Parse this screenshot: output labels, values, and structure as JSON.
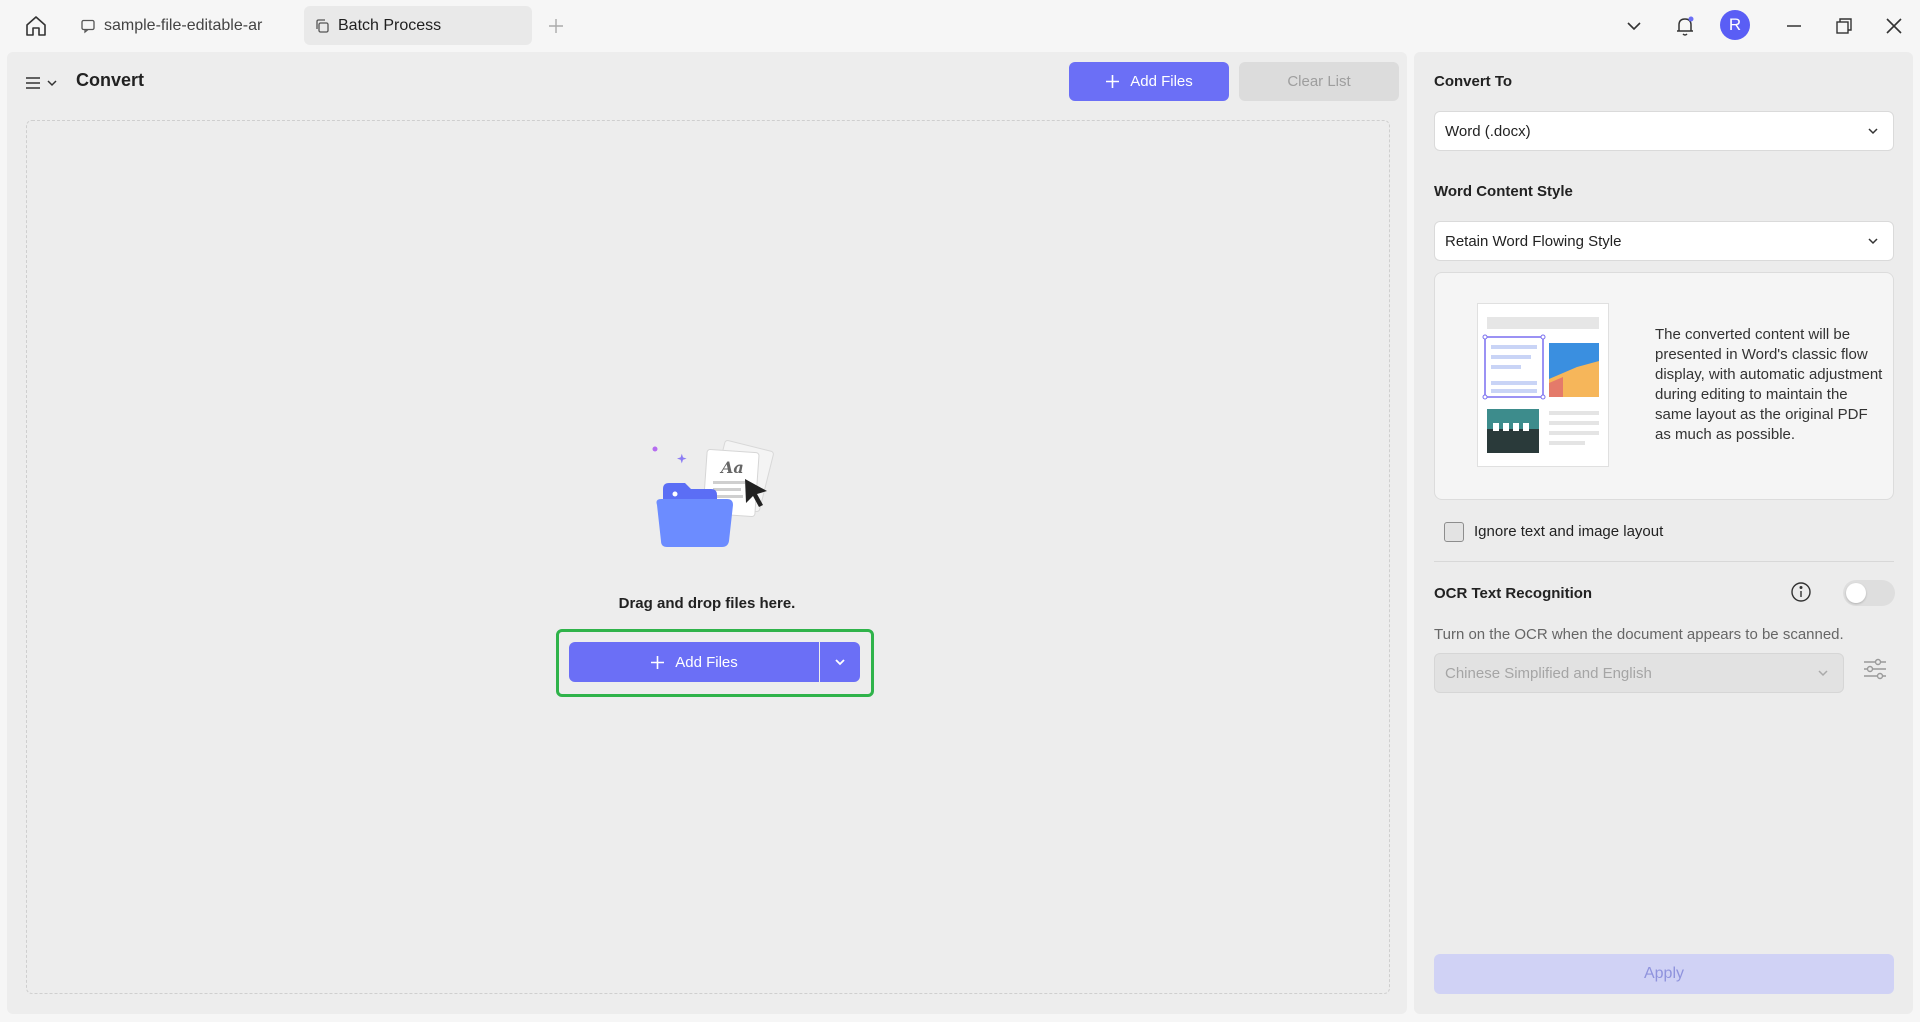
{
  "titlebar": {
    "tabs": [
      {
        "label": "sample-file-editable-ar",
        "icon": "comment-icon"
      },
      {
        "label": "Batch Process",
        "icon": "batch-copy-icon"
      }
    ],
    "avatar_letter": "R"
  },
  "main": {
    "title": "Convert",
    "add_files_label": "Add Files",
    "clear_list_label": "Clear List",
    "drop_text": "Drag and drop files here.",
    "center_add_label": "Add Files"
  },
  "side": {
    "convert_to_label": "Convert To",
    "convert_to_value": "Word (.docx)",
    "content_style_label": "Word Content Style",
    "content_style_value": "Retain Word Flowing Style",
    "style_description": "The converted content will be presented in Word's classic flow display, with automatic adjustment during editing to maintain the same layout as the original PDF as much as possible.",
    "ignore_layout_label": "Ignore text and image layout",
    "ignore_layout_checked": false,
    "ocr_label": "OCR Text Recognition",
    "ocr_enabled": false,
    "ocr_hint": "Turn on the OCR when the document appears to be scanned.",
    "ocr_language": "Chinese Simplified and English",
    "apply_label": "Apply"
  },
  "colors": {
    "accent": "#6b6ff6",
    "highlight": "#2fb34a",
    "avatar": "#5a5ef5"
  }
}
